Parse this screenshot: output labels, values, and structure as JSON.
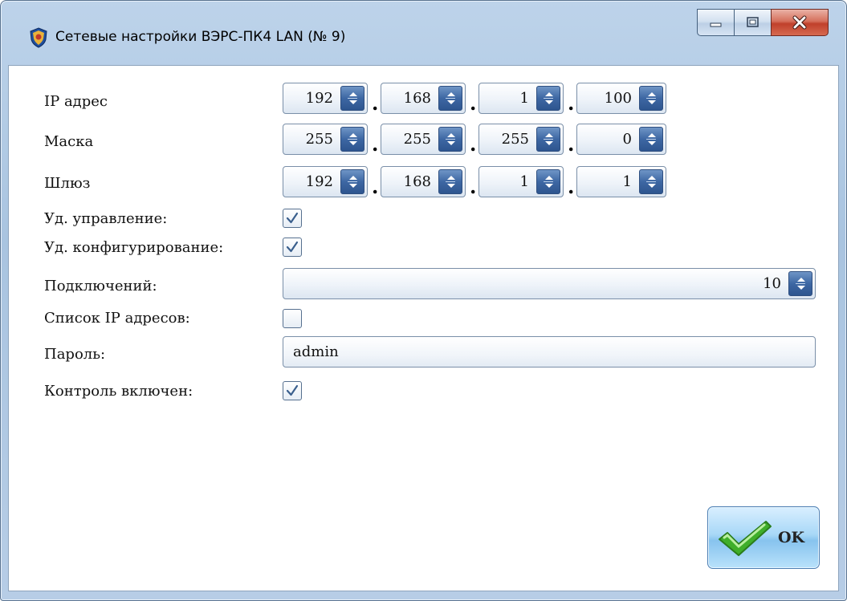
{
  "window": {
    "title": "Сетевые настройки ВЭРС-ПК4 LAN (№ 9)",
    "app_icon": "shield-emblem-icon",
    "controls": [
      "minimize-icon",
      "maximize-icon",
      "close-icon"
    ]
  },
  "form": {
    "ip": {
      "label": "IP адрес",
      "octets": [
        "192",
        "168",
        "1",
        "100"
      ]
    },
    "mask": {
      "label": "Маска",
      "octets": [
        "255",
        "255",
        "255",
        "0"
      ]
    },
    "gateway": {
      "label": "Шлюз",
      "octets": [
        "192",
        "168",
        "1",
        "1"
      ]
    },
    "remote_control": {
      "label": "Уд. управление:",
      "checked": true
    },
    "remote_config": {
      "label": "Уд. конфигурирование:",
      "checked": true
    },
    "connections": {
      "label": "Подключений:",
      "value": "10"
    },
    "ip_list": {
      "label": "Список IP адресов:",
      "checked": false
    },
    "password": {
      "label": "Пароль:",
      "value": "admin"
    },
    "monitoring": {
      "label": "Контроль включен:",
      "checked": true
    }
  },
  "footer": {
    "ok_label": "OK",
    "ok_icon": "green-checkmark-icon"
  },
  "colors": {
    "frame": "#a9c4e0",
    "spin_button": "#3d67a3",
    "close_button": "#c0402b",
    "check_mark": "#3a5f8d",
    "ok_check": "#3fae2a"
  }
}
